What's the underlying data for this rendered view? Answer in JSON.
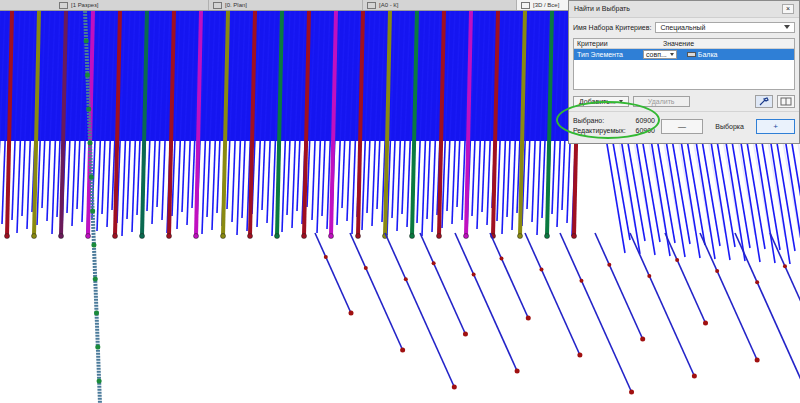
{
  "tabs": [
    {
      "label": "[1 Разрез]",
      "selected": false
    },
    {
      "label": "[0. Plan]",
      "selected": false
    },
    {
      "label": "[A0 - К]",
      "selected": false
    },
    {
      "label": "[3D / Все]",
      "selected": true
    }
  ],
  "dialog": {
    "title": "Найти и Выбрать",
    "close": "×",
    "criteria_set": {
      "label": "Имя Набора Критериев:",
      "value": "Специальный"
    },
    "table": {
      "columns": [
        "Критерии",
        "Значение"
      ],
      "rows": [
        {
          "criterion": "Тип Элемента",
          "operator": "совп...",
          "value": "Балка",
          "selected": true
        }
      ]
    },
    "add_button": {
      "label": "Добавить...",
      "disabled": false
    },
    "remove_button": {
      "label": "Удалить",
      "disabled": true
    },
    "counts": [
      {
        "label": "Выбрано:",
        "value": "60900"
      },
      {
        "label": "Редактируемых:",
        "value": "60900"
      }
    ],
    "minus_button": "—",
    "selection_label": "Выборка",
    "plus_button": "+"
  },
  "beams": [
    {
      "color": "#a01020"
    },
    {
      "color": "#8a8a10"
    },
    {
      "color": "#6a1a5a"
    },
    {
      "color": "#c010c0"
    },
    {
      "color": "#a01020"
    },
    {
      "color": "#0a6a50"
    },
    {
      "color": "#a01020"
    },
    {
      "color": "#c010c0"
    },
    {
      "color": "#8a8a10"
    },
    {
      "color": "#a01020"
    },
    {
      "color": "#0a7a40"
    },
    {
      "color": "#a01020"
    },
    {
      "color": "#c010c0"
    },
    {
      "color": "#a01020"
    },
    {
      "color": "#8a8a10"
    },
    {
      "color": "#0a7a40"
    },
    {
      "color": "#a01020"
    },
    {
      "color": "#c010c0"
    },
    {
      "color": "#a01020"
    },
    {
      "color": "#8a8a10"
    },
    {
      "color": "#0a7a40"
    },
    {
      "color": "#a01020"
    }
  ]
}
